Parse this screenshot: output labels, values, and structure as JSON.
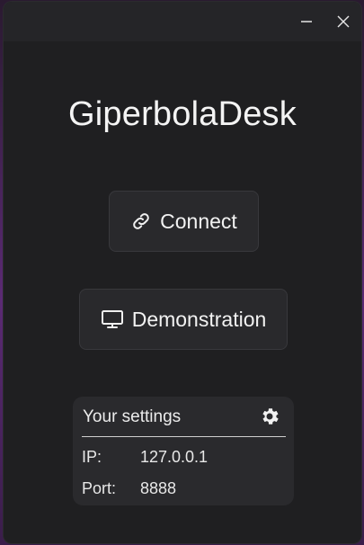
{
  "window": {
    "title": "GiperbolaDesk",
    "controls": {
      "minimize_icon": "minimize-icon",
      "close_icon": "close-icon"
    }
  },
  "actions": {
    "connect": {
      "label": "Connect",
      "icon": "link-icon"
    },
    "demonstration": {
      "label": "Demonstration",
      "icon": "monitor-icon"
    }
  },
  "settings": {
    "title": "Your settings",
    "icon": "gear-icon",
    "fields": [
      {
        "label": "IP:",
        "value": "127.0.0.1"
      },
      {
        "label": "Port:",
        "value": "8888"
      }
    ]
  },
  "colors": {
    "window_bg": "#1f1f21",
    "titlebar_bg": "#252528",
    "button_bg": "#29292c",
    "panel_bg": "#2a2a2d",
    "text": "#f1f1f1",
    "backdrop_accent": "#5b2a74"
  }
}
